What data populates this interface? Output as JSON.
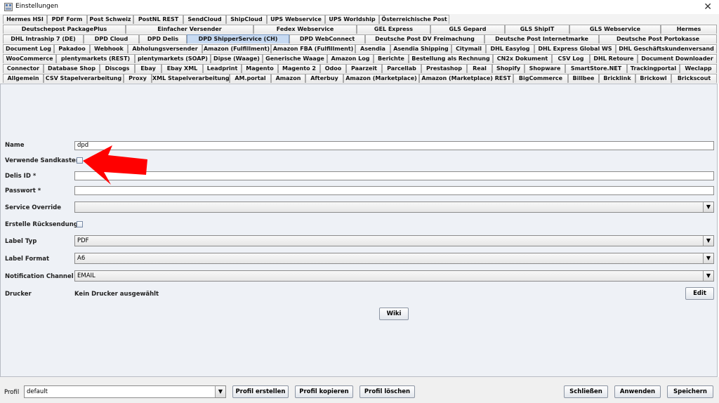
{
  "window": {
    "title": "Einstellungen",
    "close_glyph": "✕"
  },
  "tab_rows": [
    [
      "Hermes HSI",
      "PDF Form",
      "Post Schweiz",
      "PostNL REST",
      "SendCloud",
      "ShipCloud",
      "UPS Webservice",
      "UPS Worldship",
      "Österreichische Post"
    ],
    [
      "Deutschepost PackagePlus",
      "Einfacher Versender",
      "Fedex Webservice",
      "GEL Express",
      "GLS Gepard",
      "GLS ShipIT",
      "GLS Webservice",
      "Hermes"
    ],
    [
      "DHL Intraship 7 (DE)",
      "DPD Cloud",
      "DPD Delis",
      "DPD ShipperService (CH)",
      "DPD WebConnect",
      "Deutsche Post DV Freimachung",
      "Deutsche Post Internetmarke",
      "Deutsche Post Portokasse"
    ],
    [
      "Document Log",
      "Pakadoo",
      "Webhook",
      "Abholungsversender",
      "Amazon (Fulfillment)",
      "Amazon FBA (Fulfillment)",
      "Asendia",
      "Asendia Shipping",
      "Citymail",
      "DHL Easylog",
      "DHL Express Global WS",
      "DHL Geschäftskundenversand"
    ],
    [
      "WooCommerce",
      "plentymarkets (REST)",
      "plentymarkets (SOAP)",
      "Dipse (Waage)",
      "Generische Waage",
      "Amazon Log",
      "Berichte",
      "Bestellung als Rechnung",
      "CN2x Dokument",
      "CSV Log",
      "DHL Retoure",
      "Document Downloader"
    ],
    [
      "Connector",
      "Database Shop",
      "Discogs",
      "Ebay",
      "Ebay XML",
      "Leadprint",
      "Magento",
      "Magento 2",
      "Odoo",
      "Paarzeit",
      "Parcellab",
      "Prestashop",
      "Real",
      "Shopify",
      "Shopware",
      "SmartStore.NET",
      "Trackingportal",
      "Weclapp"
    ],
    [
      "Allgemein",
      "CSV Stapelverarbeitung",
      "Proxy",
      "XML Stapelverarbeitung",
      "AM.portal",
      "Amazon",
      "Afterbuy",
      "Amazon (Marketplace)",
      "Amazon (Marketplace) REST",
      "BigCommerce",
      "Billbee",
      "Bricklink",
      "Brickowl",
      "Brickscout"
    ]
  ],
  "active_tab": "DPD ShipperService (CH)",
  "form": {
    "name_label": "Name",
    "name_value": "dpd",
    "sandbox_label": "Verwende Sandkasten",
    "delis_label": "Delis ID *",
    "delis_value": "",
    "password_label": "Passwort *",
    "password_value": "",
    "service_override_label": "Service Override",
    "service_override_value": "",
    "return_label": "Erstelle Rücksendung",
    "label_type_label": "Label Typ",
    "label_type_value": "PDF",
    "label_format_label": "Label Format",
    "label_format_value": "A6",
    "notification_label": "Notification Channel",
    "notification_value": "EMAIL",
    "printer_label": "Drucker",
    "printer_value": "Kein Drucker ausgewählt",
    "edit_button": "Edit",
    "wiki_button": "Wiki"
  },
  "bottom": {
    "profile_label": "Profil",
    "profile_value": "default",
    "create_profile": "Profil erstellen",
    "copy_profile": "Profil kopieren",
    "delete_profile": "Profil löschen",
    "close": "Schließen",
    "apply": "Anwenden",
    "save": "Speichern"
  },
  "icons": {
    "dropdown": "chevron-down-icon",
    "close": "close-icon",
    "app": "app-icon",
    "annotation": "red-arrow-annotation"
  },
  "colors": {
    "active_tab": "#c7daf2",
    "panel_bg": "#eef1f6",
    "arrow": "#ff0000"
  }
}
